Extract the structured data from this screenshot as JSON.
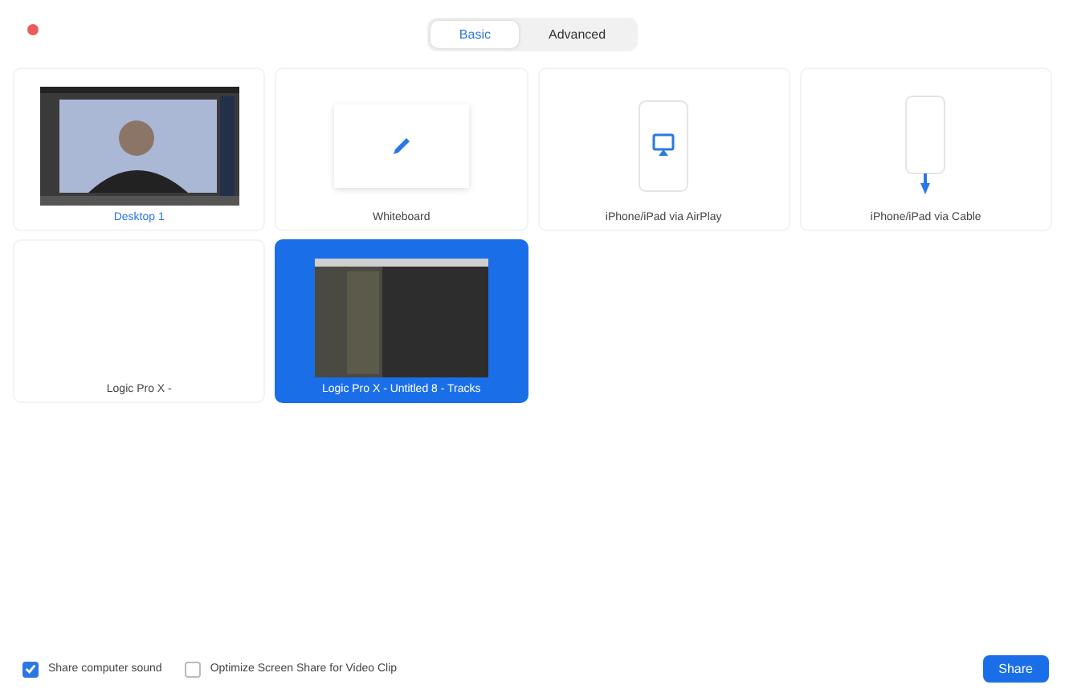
{
  "tabs": [
    {
      "label": "Basic",
      "selected": true
    },
    {
      "label": "Advanced",
      "selected": false
    }
  ],
  "tiles": [
    {
      "kind": "desktop",
      "label": "Desktop 1",
      "selected": false
    },
    {
      "kind": "whiteboard",
      "label": "Whiteboard",
      "selected": false
    },
    {
      "kind": "airplay",
      "label": "iPhone/iPad via AirPlay",
      "selected": false
    },
    {
      "kind": "cable",
      "label": "iPhone/iPad via Cable",
      "selected": false
    },
    {
      "kind": "blank",
      "label": "Logic Pro X -",
      "selected": false
    },
    {
      "kind": "window",
      "label": "Logic Pro X - Untitled 8 - Tracks",
      "selected": true
    }
  ],
  "options": [
    {
      "label": "Share computer sound",
      "checked": true
    },
    {
      "label": "Optimize Screen Share for Video Clip",
      "checked": false
    }
  ],
  "share_button": "Share"
}
